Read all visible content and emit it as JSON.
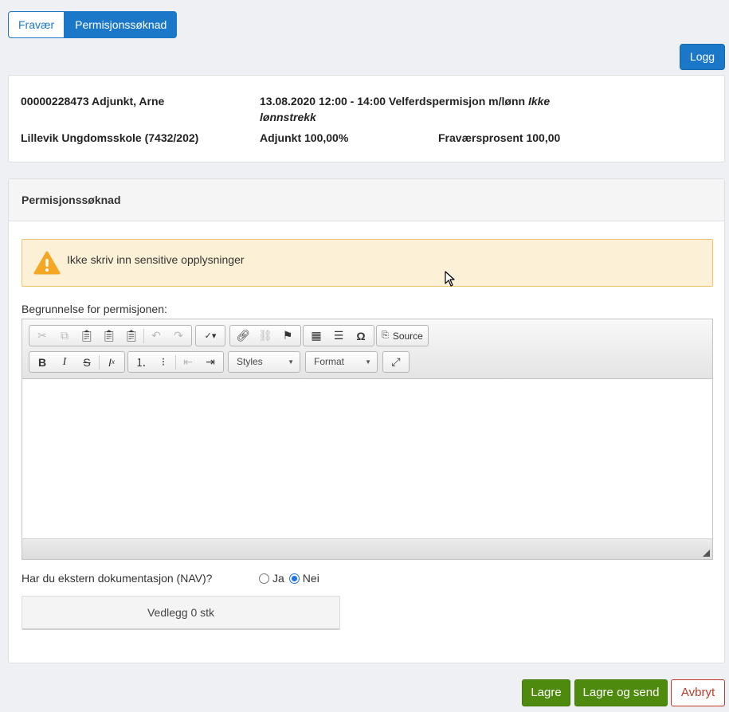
{
  "tabs": [
    {
      "label": "Fravær",
      "active": false
    },
    {
      "label": "Permisjonssøknad",
      "active": true
    }
  ],
  "logg_label": "Logg",
  "info": {
    "employee": "00000228473 Adjunkt, Arne",
    "period": "13.08.2020 12:00 - 14:00 Velferdspermisjon m/lønn",
    "period_note_1": "Ikke",
    "period_note_2": "lønnstrekk",
    "school": "Lillevik Ungdomsskole (7432/202)",
    "position": "Adjunkt 100,00%",
    "absence_percent": "Fraværsprosent 100,00"
  },
  "form": {
    "panel_title": "Permisjonssøknad",
    "warning_text": "Ikke skriv inn sensitive opplysninger",
    "reason_label": "Begrunnelse for permisjonen:",
    "editor": {
      "source_label": "Source",
      "styles_label": "Styles",
      "format_label": "Format",
      "content": ""
    },
    "external_doc_label": "Har du ekstern dokumentasjon (NAV)?",
    "radio_yes": "Ja",
    "radio_no": "Nei",
    "selected": "Nei",
    "attachment_label": "Vedlegg 0 stk"
  },
  "actions": {
    "save": "Lagre",
    "save_send": "Lagre og send",
    "cancel": "Avbryt"
  },
  "colors": {
    "primary": "#1b78c9",
    "success": "#4e8a0d",
    "danger": "#c0392b",
    "warning_bg": "#fcf1d6",
    "warning_border": "#f0c36d",
    "warning_icon": "#f5a623"
  }
}
